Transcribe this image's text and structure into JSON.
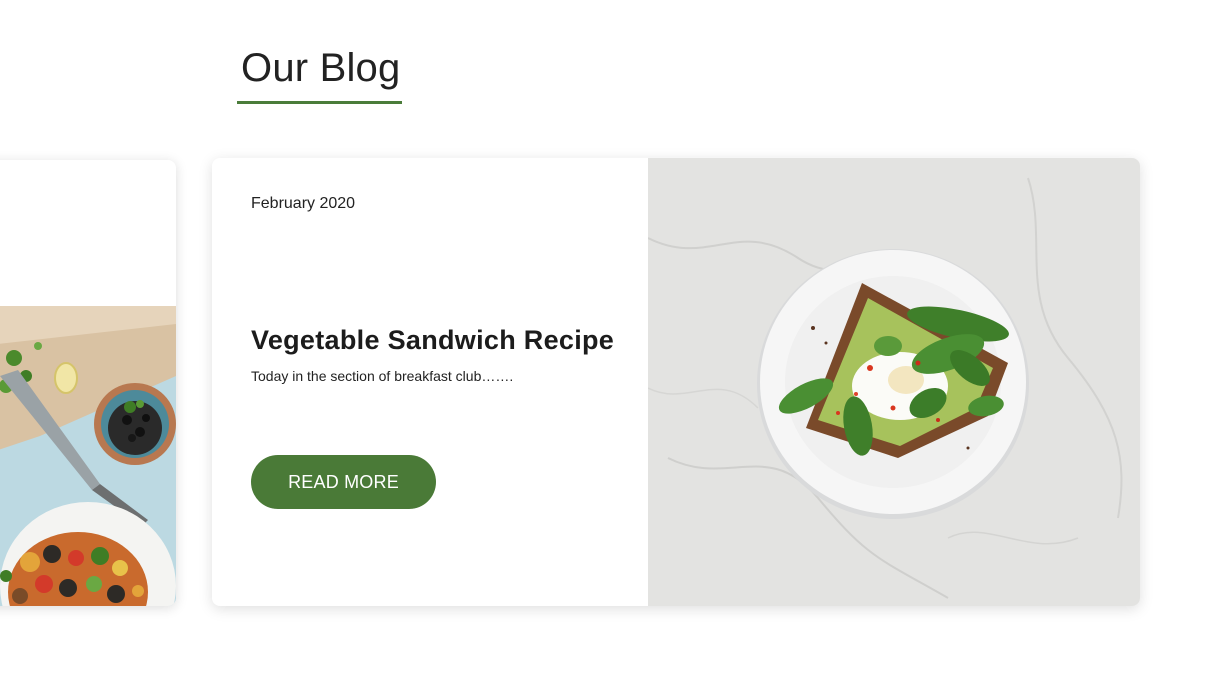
{
  "section": {
    "title": "Our Blog",
    "accent_color": "#4a7c3a"
  },
  "prev_post": {
    "image_icon": "food-bowl-photo"
  },
  "post": {
    "date": "February 2020",
    "title": "Vegetable Sandwich Recipe",
    "excerpt": "Today in the section of breakfast club…….",
    "button_label": "READ MORE",
    "button_color": "#4a7a37",
    "image_icon": "avocado-toast-plate-photo"
  }
}
